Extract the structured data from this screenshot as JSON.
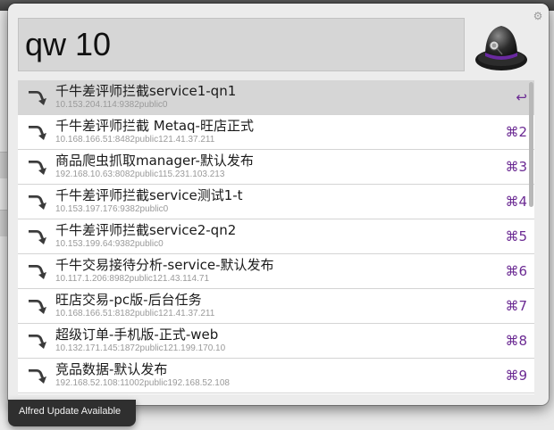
{
  "search": {
    "query": "qw 10"
  },
  "results": [
    {
      "title": "千牛差评师拦截service1-qn1",
      "subtitle": "10.153.204.114:9382public0",
      "shortcut": "↩",
      "selected": true
    },
    {
      "title": "千牛差评师拦截 Metaq-旺店正式",
      "subtitle": "10.168.166.51:8482public121.41.37.211",
      "shortcut": "⌘2",
      "selected": false
    },
    {
      "title": "商品爬虫抓取manager-默认发布",
      "subtitle": "192.168.10.63:8082public115.231.103.213",
      "shortcut": "⌘3",
      "selected": false
    },
    {
      "title": "千牛差评师拦截service测试1-t",
      "subtitle": "10.153.197.176:9382public0",
      "shortcut": "⌘4",
      "selected": false
    },
    {
      "title": "千牛差评师拦截service2-qn2",
      "subtitle": "10.153.199.64:9382public0",
      "shortcut": "⌘5",
      "selected": false
    },
    {
      "title": "千牛交易接待分析-service-默认发布",
      "subtitle": "10.117.1.206:8982public121.43.114.71",
      "shortcut": "⌘6",
      "selected": false
    },
    {
      "title": "旺店交易-pc版-后台任务",
      "subtitle": "10.168.166.51:8182public121.41.37.211",
      "shortcut": "⌘7",
      "selected": false
    },
    {
      "title": "超级订单-手机版-正式-web",
      "subtitle": "10.132.171.145:1872public121.199.170.10",
      "shortcut": "⌘8",
      "selected": false
    },
    {
      "title": "竞品数据-默认发布",
      "subtitle": "192.168.52.108:11002public192.168.52.108",
      "shortcut": "⌘9",
      "selected": false
    }
  ],
  "icons": {
    "app": "alfred-hat-icon",
    "result": "ssh-arrow-icon",
    "settings": "gear-icon"
  },
  "colors": {
    "shortcut": "#6b2a93",
    "selected_row": "#d6d6d6",
    "window_bg": "#ececec",
    "notice_bg": "#2f2f2f"
  },
  "notice": {
    "text": "Alfred Update Available"
  }
}
